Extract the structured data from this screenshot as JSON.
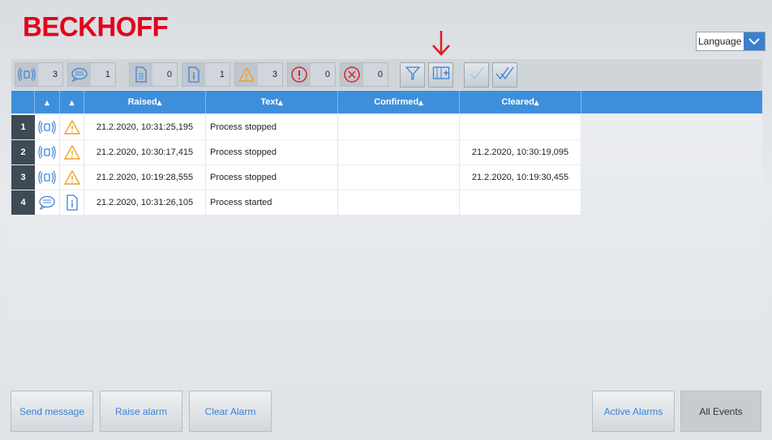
{
  "brand": "BECKHOFF",
  "language": {
    "label": "Language"
  },
  "counters": [
    {
      "icon": "alarm-icon",
      "value": "3"
    },
    {
      "icon": "message-icon",
      "value": "1"
    },
    {
      "icon": "document-icon",
      "value": "0"
    },
    {
      "icon": "info-icon",
      "value": "1"
    },
    {
      "icon": "warning-icon",
      "value": "3"
    },
    {
      "icon": "error-icon",
      "value": "0"
    },
    {
      "icon": "critical-icon",
      "value": "0"
    }
  ],
  "toolbar_buttons": [
    "filter-icon",
    "column-settings-icon",
    "confirm-icon",
    "confirm-all-icon"
  ],
  "columns": [
    "",
    "",
    "Raised",
    "Text",
    "Confirmed",
    "Cleared"
  ],
  "rows": [
    {
      "num": "1",
      "type": "alarm-icon",
      "severity": "warning-icon",
      "raised": "21.2.2020, 10:31:25,195",
      "text": "Process stopped",
      "confirmed": "",
      "cleared": ""
    },
    {
      "num": "2",
      "type": "alarm-icon",
      "severity": "warning-icon",
      "raised": "21.2.2020, 10:30:17,415",
      "text": "Process stopped",
      "confirmed": "",
      "cleared": "21.2.2020, 10:30:19,095"
    },
    {
      "num": "3",
      "type": "alarm-icon",
      "severity": "warning-icon",
      "raised": "21.2.2020, 10:19:28,555",
      "text": "Process stopped",
      "confirmed": "",
      "cleared": "21.2.2020, 10:19:30,455"
    },
    {
      "num": "4",
      "type": "message-icon",
      "severity": "info-icon",
      "raised": "21.2.2020, 10:31:26,105",
      "text": "Process started",
      "confirmed": "",
      "cleared": ""
    }
  ],
  "buttons": {
    "send_message": "Send message",
    "raise_alarm": "Raise alarm",
    "clear_alarm": "Clear Alarm",
    "active_alarms": "Active Alarms",
    "all_events": "All Events"
  },
  "colors": {
    "brand": "#e2001a",
    "header": "#3d8fdc",
    "accent": "#3b7fd0",
    "warning": "#f0a020",
    "error": "#e02020"
  }
}
